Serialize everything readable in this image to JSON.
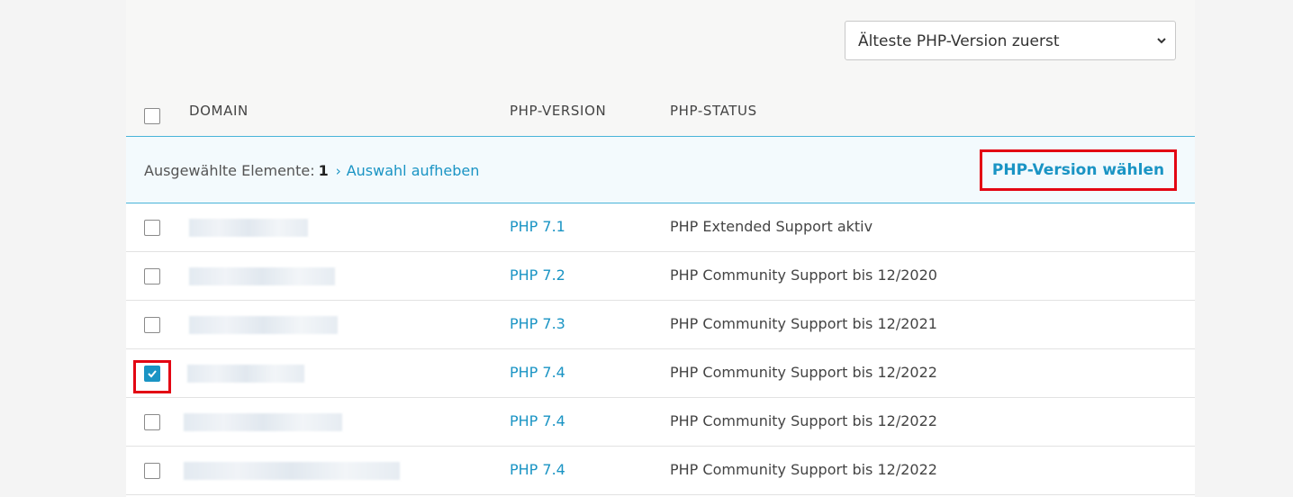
{
  "sort": {
    "selected": "Älteste PHP-Version zuerst"
  },
  "table": {
    "headers": {
      "domain": "DOMAIN",
      "php_version": "PHP-VERSION",
      "php_status": "PHP-STATUS"
    },
    "rows": [
      {
        "version": "PHP 7.1",
        "status": "PHP Extended Support aktiv",
        "checked": false
      },
      {
        "version": "PHP 7.2",
        "status": "PHP Community Support bis 12/2020",
        "checked": false
      },
      {
        "version": "PHP 7.3",
        "status": "PHP Community Support bis 12/2021",
        "checked": false
      },
      {
        "version": "PHP 7.4",
        "status": "PHP Community Support bis 12/2022",
        "checked": true
      },
      {
        "version": "PHP 7.4",
        "status": "PHP Community Support bis 12/2022",
        "checked": false
      },
      {
        "version": "PHP 7.4",
        "status": "PHP Community Support bis 12/2022",
        "checked": false
      }
    ]
  },
  "selection": {
    "label": "Ausgewählte Elemente:",
    "count": "1",
    "clear_label": "Auswahl aufheben",
    "action_label": "PHP-Version wählen"
  },
  "colors": {
    "accent": "#1a94c4",
    "highlight": "#e30613"
  }
}
